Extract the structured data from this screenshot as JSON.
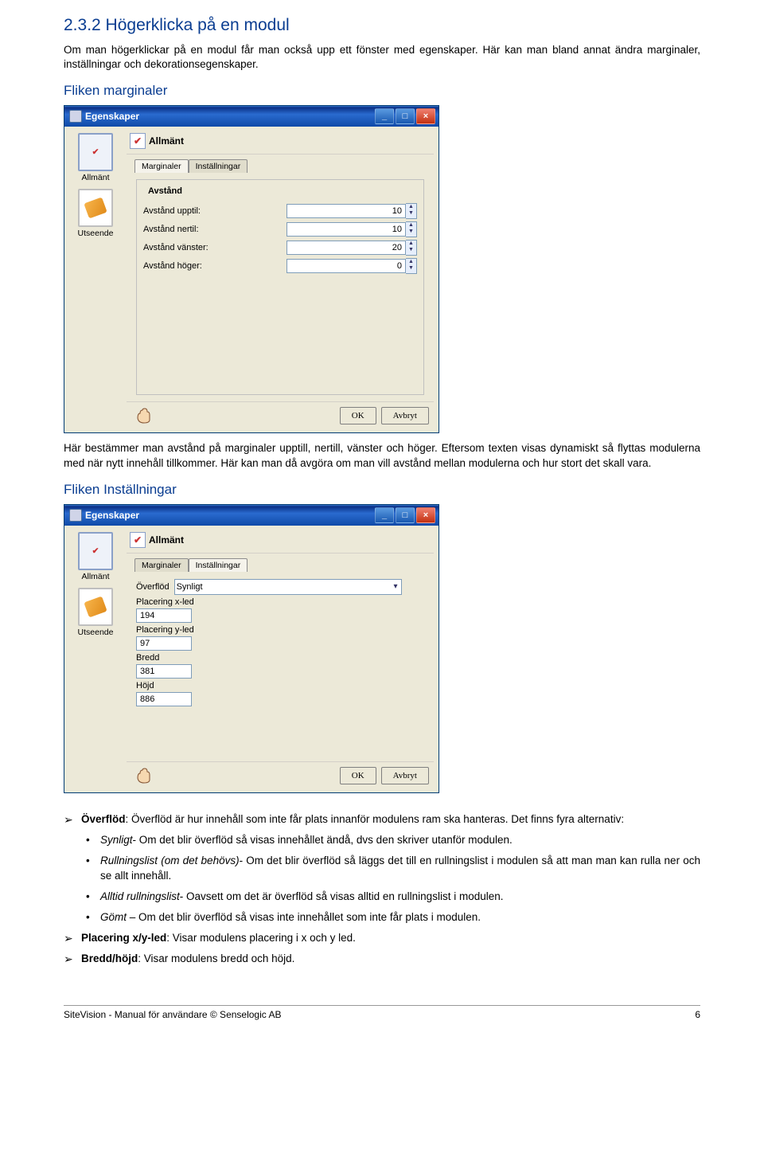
{
  "section_heading": "2.3.2 Högerklicka på en modul",
  "intro_text": "Om man högerklickar på en modul får man också upp ett fönster med egenskaper. Här kan man bland annat ändra marginaler, inställningar och dekorationsegenskaper.",
  "sub1_heading": "Fliken marginaler",
  "sub1_desc": "Här bestämmer man avstånd på marginaler upptill, nertill, vänster och höger. Eftersom texten visas dynamiskt så flyttas modulerna med när nytt innehåll tillkommer. Här kan man då avgöra om man vill avstånd mellan modulerna och hur stort det skall vara.",
  "sub2_heading": "Fliken Inställningar",
  "dialog1": {
    "title": "Egenskaper",
    "sidebar": [
      {
        "label": "Allmänt",
        "active": true
      },
      {
        "label": "Utseende",
        "active": false
      }
    ],
    "general_label": "Allmänt",
    "tabs": [
      {
        "label": "Marginaler",
        "active": true
      },
      {
        "label": "Inställningar",
        "active": false
      }
    ],
    "group_label": "Avstånd",
    "fields": [
      {
        "label": "Avstånd upptil:",
        "value": "10"
      },
      {
        "label": "Avstånd nertil:",
        "value": "10"
      },
      {
        "label": "Avstånd vänster:",
        "value": "20"
      },
      {
        "label": "Avstånd höger:",
        "value": "0"
      }
    ],
    "ok": "OK",
    "cancel": "Avbryt"
  },
  "dialog2": {
    "title": "Egenskaper",
    "sidebar": [
      {
        "label": "Allmänt",
        "active": true
      },
      {
        "label": "Utseende",
        "active": false
      }
    ],
    "general_label": "Allmänt",
    "tabs": [
      {
        "label": "Marginaler",
        "active": false
      },
      {
        "label": "Inställningar",
        "active": true
      }
    ],
    "overflow_label": "Överflöd",
    "overflow_value": "Synligt",
    "fields": [
      {
        "label": "Placering x-led",
        "value": "194"
      },
      {
        "label": "Placering y-led",
        "value": "97"
      },
      {
        "label": "Bredd",
        "value": "381"
      },
      {
        "label": "Höjd",
        "value": "886"
      }
    ],
    "ok": "OK",
    "cancel": "Avbryt"
  },
  "bullets": {
    "over_lead_b": "Överflöd",
    "over_lead_rest": ": Överflöd är hur innehåll som inte får plats innanför modulens ram ska hanteras. Det finns fyra alternativ:",
    "sub1_i": "Synligt",
    "sub1_rest": "- Om det blir överflöd så visas innehållet ändå, dvs den skriver utanför modulen.",
    "sub2_i": "Rullningslist (om det behövs)",
    "sub2_rest": "- Om det blir överflöd så läggs det till en rullningslist i modulen så att man man kan rulla ner och se allt innehåll.",
    "sub3_i": "Alltid rullningslist",
    "sub3_rest": "- Oavsett om det är överflöd så visas alltid en rullningslist i modulen.",
    "sub4_i": "Gömt",
    "sub4_rest": " – Om det blir överflöd så visas inte innehållet som inte får plats i modulen.",
    "place_b": "Placering x/y-led",
    "place_rest": ": Visar modulens placering i x och y led.",
    "dim_b": "Bredd/höjd",
    "dim_rest": ": Visar modulens bredd och höjd."
  },
  "footer_left": "SiteVision - Manual för användare © Senselogic AB",
  "footer_right": "6"
}
